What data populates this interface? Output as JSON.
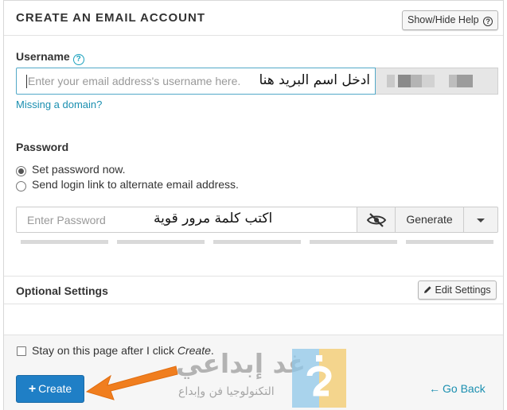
{
  "header": {
    "title": "CREATE AN EMAIL ACCOUNT",
    "help_label": "Show/Hide Help",
    "help_glyph": "?"
  },
  "username": {
    "label": "Username",
    "help_glyph": "?",
    "placeholder": "Enter your email address's username here.",
    "annotation_ar": "ادخل اسم البريد هنا",
    "missing_domain_link": "Missing a domain?"
  },
  "password": {
    "label": "Password",
    "options": [
      {
        "label": "Set password now.",
        "selected": true
      },
      {
        "label": "Send login link to alternate email address.",
        "selected": false
      }
    ],
    "placeholder": "Enter Password",
    "annotation_ar": "اكتب كلمة مرور قوية",
    "visibility_icon": "eye-slash-icon",
    "generate_label": "Generate",
    "strength_segments": 5
  },
  "optional": {
    "title": "Optional Settings",
    "edit_label": "Edit Settings",
    "edit_icon": "pencil-icon"
  },
  "footer": {
    "stay_prefix": "Stay on this page after I click ",
    "stay_emphasis": "Create",
    "stay_suffix": ".",
    "stay_checked": false,
    "create_label": "Create",
    "back_label": "Go Back"
  },
  "watermark": {
    "brand_ar": "غد إبداعي",
    "tagline_ar": "التكنولوجيا فن وإبداع"
  },
  "colors": {
    "primary_button": "#1f7fc6",
    "link": "#1a8fb0",
    "input_focus_border": "#53a9c8",
    "annotation_arrow": "#f07e1f",
    "logo_blue": "#8fc7e8",
    "logo_yellow": "#f3c96a"
  }
}
